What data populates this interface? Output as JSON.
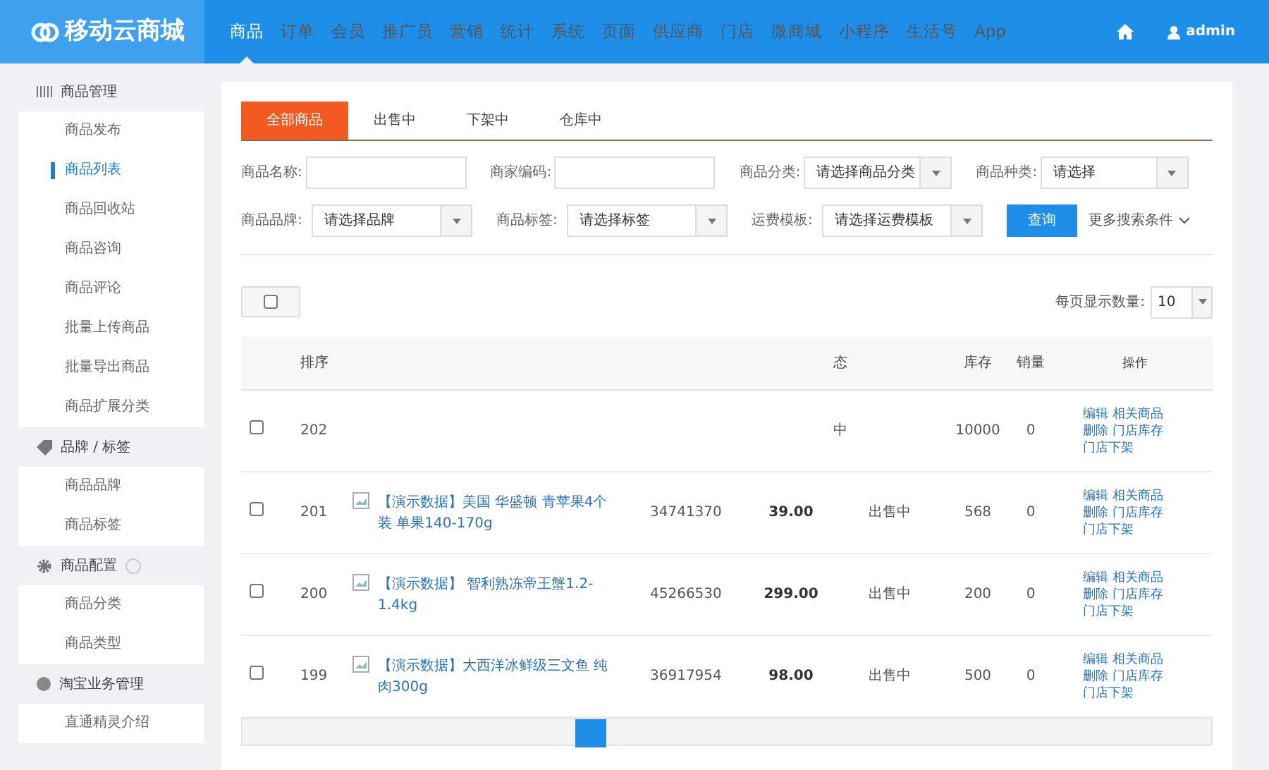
{
  "brand": "移动云商城",
  "top_nav": [
    {
      "label": "商品",
      "selected": true
    },
    {
      "label": "订单",
      "selected": false
    },
    {
      "label": "会员",
      "selected": false
    },
    {
      "label": "推广员",
      "selected": false
    },
    {
      "label": "营销",
      "selected": false
    },
    {
      "label": "统计",
      "selected": false
    },
    {
      "label": "系统",
      "selected": false
    },
    {
      "label": "页面",
      "selected": false
    },
    {
      "label": "供应商",
      "selected": false
    },
    {
      "label": "门店",
      "selected": false
    },
    {
      "label": "微商城",
      "selected": false
    },
    {
      "label": "小程序",
      "selected": false
    },
    {
      "label": "生活号",
      "selected": false
    },
    {
      "label": "App",
      "selected": false
    }
  ],
  "user": "admin",
  "sidebar": [
    {
      "title": "商品管理",
      "kind": "list",
      "help": false,
      "items": [
        {
          "label": "商品发布",
          "selected": false
        },
        {
          "label": "商品列表",
          "selected": true
        },
        {
          "label": "商品回收站",
          "selected": false
        },
        {
          "label": "商品咨询",
          "selected": false
        },
        {
          "label": "商品评论",
          "selected": false
        },
        {
          "label": "批量上传商品",
          "selected": false
        },
        {
          "label": "批量导出商品",
          "selected": false
        },
        {
          "label": "商品扩展分类",
          "selected": false
        }
      ]
    },
    {
      "title": "品牌 / 标签",
      "kind": "tag",
      "help": false,
      "items": [
        {
          "label": "商品品牌",
          "selected": false
        },
        {
          "label": "商品标签",
          "selected": false
        }
      ]
    },
    {
      "title": "商品配置",
      "kind": "gear",
      "help": true,
      "items": [
        {
          "label": "商品分类",
          "selected": false
        },
        {
          "label": "商品类型",
          "selected": false
        }
      ]
    },
    {
      "title": "淘宝业务管理",
      "kind": "circle",
      "help": false,
      "items": [
        {
          "label": "直通精灵介绍",
          "selected": false
        }
      ]
    }
  ],
  "tabs": [
    {
      "label": "全部商品",
      "selected": true
    },
    {
      "label": "出售中",
      "selected": false
    },
    {
      "label": "下架中",
      "selected": false
    },
    {
      "label": "仓库中",
      "selected": false
    }
  ],
  "filters": [
    [
      {
        "label": "商品名称:",
        "kind": "input"
      },
      {
        "label": "商家编码:",
        "kind": "input"
      },
      {
        "label": "商品分类:",
        "kind": "select",
        "value": "请选择商品分类"
      },
      {
        "label": "商品种类:",
        "kind": "select",
        "value": "请选择"
      }
    ],
    [
      {
        "label": "商品品牌:",
        "kind": "select",
        "value": "请选择品牌"
      },
      {
        "label": "商品标签:",
        "kind": "select",
        "value": "请选择标签"
      },
      {
        "label": "运费模板:",
        "kind": "select",
        "value": "请选择运费模板"
      }
    ]
  ],
  "search_button": "查询",
  "more_filters": "更多搜索条件",
  "page_size": {
    "label": "每页显示数量:",
    "value": "10"
  },
  "table": {
    "columns": [
      "排序",
      "态",
      "库存",
      "销量",
      "操作"
    ],
    "rows": [
      {
        "checked": false,
        "sort": "202",
        "status": "中",
        "stock": "10000",
        "sales": "0",
        "actions": [
          "编辑",
          "相关商品",
          "删除",
          "门店库存",
          "门店下架"
        ]
      },
      {
        "checked": false,
        "sort": "201",
        "name": "【演示数据】美国 华盛顿 青苹果4个装 单果140-170g",
        "code": "34741370",
        "price": "39.00",
        "status": "出售中",
        "stock": "568",
        "sales": "0",
        "actions": [
          "编辑",
          "相关商品",
          "删除",
          "门店库存",
          "门店下架"
        ]
      },
      {
        "checked": false,
        "sort": "200",
        "name": "【演示数据】 智利熟冻帝王蟹1.2-1.4kg",
        "code": "45266530",
        "price": "299.00",
        "status": "出售中",
        "stock": "200",
        "sales": "0",
        "actions": [
          "编辑",
          "相关商品",
          "删除",
          "门店库存",
          "门店下架"
        ]
      },
      {
        "checked": false,
        "sort": "199",
        "name": "【演示数据】大西洋冰鲜级三文鱼 纯肉300g",
        "code": "36917954",
        "price": "98.00",
        "status": "出售中",
        "stock": "500",
        "sales": "0",
        "actions": [
          "编辑",
          "相关商品",
          "删除",
          "门店库存",
          "门店下架"
        ]
      }
    ]
  }
}
